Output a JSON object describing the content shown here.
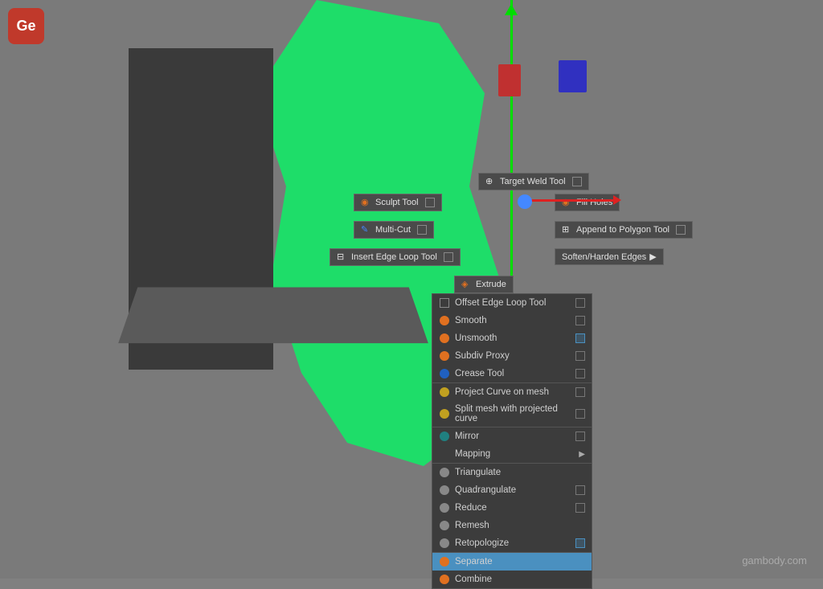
{
  "app": {
    "logo": "Ge",
    "watermark": "gambody.com"
  },
  "toolbar": {
    "target_weld_tool": "Target Weld Tool",
    "sculpt_tool": "Sculpt Tool",
    "fill_holes": "Fill Holes",
    "multi_cut": "Multi-Cut",
    "append_polygon": "Append to Polygon Tool",
    "insert_edge_loop": "Insert Edge Loop Tool",
    "soften_harden": "Soften/Harden Edges",
    "extrude": "Extrude"
  },
  "context_menu": {
    "items": [
      {
        "id": "offset-edge-loop",
        "label": "Offset Edge Loop Tool",
        "icon": "grid",
        "has_check": true,
        "checked": false,
        "has_arrow": false,
        "active": false
      },
      {
        "id": "smooth",
        "label": "Smooth",
        "icon": "circle-orange",
        "has_check": true,
        "checked": false,
        "has_arrow": false,
        "active": false
      },
      {
        "id": "unsmooth",
        "label": "Unsmooth",
        "icon": "circle-orange",
        "has_check": true,
        "checked": true,
        "has_arrow": false,
        "active": false
      },
      {
        "id": "subdiv-proxy",
        "label": "Subdiv Proxy",
        "icon": "circle-orange",
        "has_check": true,
        "checked": false,
        "has_arrow": false,
        "active": false
      },
      {
        "id": "crease-tool",
        "label": "Crease Tool",
        "icon": "circle-blue",
        "has_check": true,
        "checked": false,
        "has_arrow": false,
        "active": false
      },
      {
        "id": "project-curve",
        "label": "Project Curve on mesh",
        "icon": "circle-yellow",
        "has_check": true,
        "checked": false,
        "has_arrow": false,
        "active": false,
        "separator": true
      },
      {
        "id": "split-mesh",
        "label": "Split mesh with projected curve",
        "icon": "circle-yellow",
        "has_check": true,
        "checked": false,
        "has_arrow": false,
        "active": false
      },
      {
        "id": "mirror",
        "label": "Mirror",
        "icon": "circle-teal",
        "has_check": true,
        "checked": false,
        "has_arrow": false,
        "active": false,
        "separator": true
      },
      {
        "id": "mapping",
        "label": "Mapping",
        "icon": "",
        "has_check": false,
        "checked": false,
        "has_arrow": true,
        "active": false
      },
      {
        "id": "triangulate",
        "label": "Triangulate",
        "icon": "circle-gray",
        "has_check": false,
        "checked": false,
        "has_arrow": false,
        "active": false,
        "separator": true
      },
      {
        "id": "quadrangulate",
        "label": "Quadrangulate",
        "icon": "circle-gray",
        "has_check": true,
        "checked": false,
        "has_arrow": false,
        "active": false
      },
      {
        "id": "reduce",
        "label": "Reduce",
        "icon": "circle-gray",
        "has_check": true,
        "checked": false,
        "has_arrow": false,
        "active": false
      },
      {
        "id": "remesh",
        "label": "Remesh",
        "icon": "circle-gray",
        "has_check": false,
        "checked": false,
        "has_arrow": false,
        "active": false
      },
      {
        "id": "retopologize",
        "label": "Retopologize",
        "icon": "circle-gray",
        "has_check": true,
        "checked": true,
        "has_arrow": false,
        "active": false
      },
      {
        "id": "separate",
        "label": "Separate",
        "icon": "circle-orange",
        "has_check": false,
        "checked": false,
        "has_arrow": false,
        "active": true,
        "separator": true
      },
      {
        "id": "combine",
        "label": "Combine",
        "icon": "circle-orange",
        "has_check": false,
        "checked": false,
        "has_arrow": false,
        "active": false
      }
    ]
  }
}
